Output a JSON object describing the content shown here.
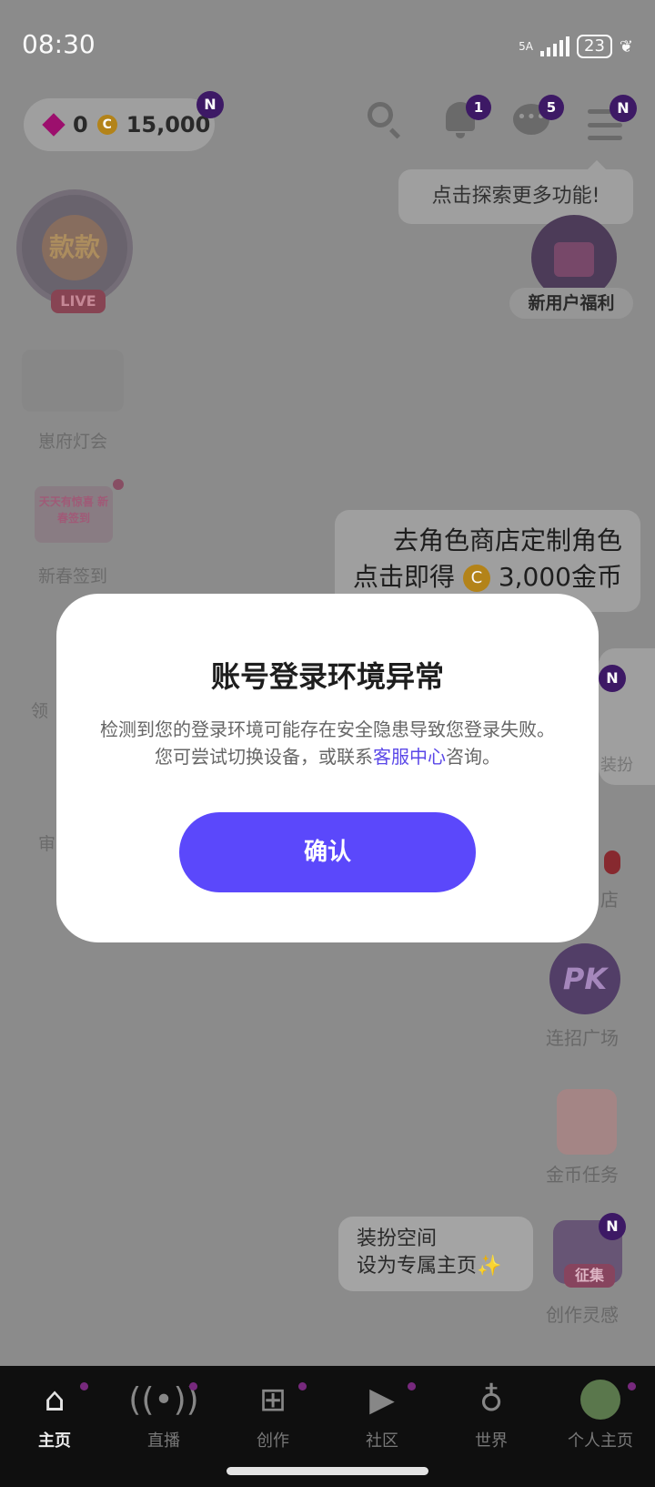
{
  "status_bar": {
    "time": "08:30",
    "network": "5A",
    "battery": "23"
  },
  "header": {
    "gems": "0",
    "coins": "15,000",
    "pill_badge": "N",
    "bell_count": "1",
    "chat_count": "5",
    "menu_badge": "N"
  },
  "tooltip": {
    "text": "点击探索更多功能!"
  },
  "left_column": {
    "live_avatar_text": "款款",
    "live_tag": "LIVE",
    "lantern_label": "崽府灯会",
    "checkin_thumb_text": "天天有惊喜 新春签到",
    "checkin_label": "新春签到",
    "partial_1": "领",
    "partial_2": "审"
  },
  "right_column": {
    "newuser_label": "新用户福利",
    "shop_tip_line1": "去角色商店定制角色",
    "shop_tip_line2_prefix": "点击即得",
    "shop_tip_coin_symbol": "C",
    "shop_tip_amount": "3,000金币",
    "shop_card_badge": "N",
    "shop_card_text": "装扮",
    "store_label": "店",
    "pk_text": "PK",
    "pk_label": "连招广场",
    "task_label": "金币任务",
    "dressup_line1": "装扮空间",
    "dressup_line2": "设为专属主页",
    "dressup_sparkle": "✨",
    "inspire_tag": "征集",
    "inspire_badge": "N",
    "inspire_label": "创作灵感"
  },
  "bottom_nav": {
    "items": [
      {
        "label": "主页",
        "icon": "home-icon"
      },
      {
        "label": "直播",
        "icon": "broadcast-icon"
      },
      {
        "label": "创作",
        "icon": "video-add-icon"
      },
      {
        "label": "社区",
        "icon": "play-square-icon"
      },
      {
        "label": "世界",
        "icon": "planet-icon"
      },
      {
        "label": "个人主页",
        "icon": "avatar"
      }
    ],
    "active_index": 0
  },
  "dialog": {
    "title": "账号登录环境异常",
    "body_prefix": "检测到您的登录环境可能存在安全隐患导致您登录失败。您可尝试切换设备，或联系",
    "body_link": "客服中心",
    "body_suffix": "咨询。",
    "confirm_label": "确认"
  },
  "colors": {
    "accent": "#5b48fb",
    "link": "#5b48e8",
    "nav_bg": "#101010"
  }
}
